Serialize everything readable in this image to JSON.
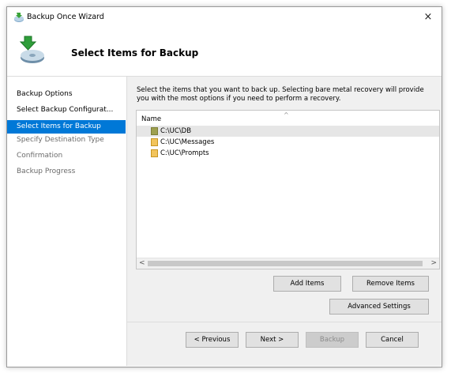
{
  "window": {
    "title": "Backup Once Wizard",
    "close_label": "×"
  },
  "header": {
    "title": "Select Items for Backup"
  },
  "nav": {
    "items": [
      {
        "label": "Backup Options",
        "state": "normal"
      },
      {
        "label": "Select Backup Configurat...",
        "state": "normal"
      },
      {
        "label": "Select Items for Backup",
        "state": "selected"
      },
      {
        "label": "Specify Destination Type",
        "state": "dim"
      },
      {
        "label": "Confirmation",
        "state": "dim"
      },
      {
        "label": "Backup Progress",
        "state": "dim"
      }
    ]
  },
  "main": {
    "description_line1": "Select the items that you want to back up. Selecting bare metal recovery will provide",
    "description_line2": "you with the most options if you need to perform a recovery.",
    "list": {
      "column_header": "Name",
      "sort_indicator": "^",
      "items": [
        {
          "label": "C:\\UC\\DB",
          "checked": "partial",
          "highlighted": true
        },
        {
          "label": "C:\\UC\\Messages",
          "checked": "unchecked",
          "highlighted": false
        },
        {
          "label": "C:\\UC\\Prompts",
          "checked": "unchecked",
          "highlighted": false
        }
      ],
      "scroll_left": "<",
      "scroll_right": ">"
    },
    "buttons": {
      "add_items": "Add Items",
      "remove_items": "Remove Items",
      "advanced_settings": "Advanced Settings"
    }
  },
  "footer": {
    "previous": "< Previous",
    "next": "Next >",
    "backup": "Backup",
    "backup_enabled": false,
    "cancel": "Cancel"
  },
  "colors": {
    "accent": "#0078d7",
    "panel": "#f0f0f0",
    "checkbox": "#f2c45c",
    "checkbox_partial": "#9ea04f"
  }
}
